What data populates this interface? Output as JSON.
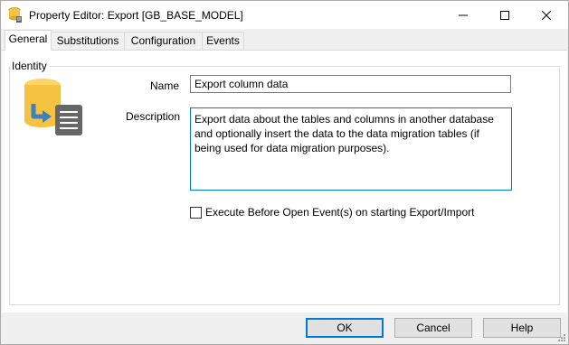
{
  "window": {
    "title": "Property Editor: Export [GB_BASE_MODEL]",
    "controls": {
      "minimize": "minimize-icon",
      "maximize": "maximize-icon",
      "close": "close-icon"
    }
  },
  "tabs": [
    {
      "label": "General",
      "active": true
    },
    {
      "label": "Substitutions",
      "active": false
    },
    {
      "label": "Configuration",
      "active": false
    },
    {
      "label": "Events",
      "active": false
    }
  ],
  "identity": {
    "group_label": "Identity",
    "icon": "database-export-icon",
    "name_label": "Name",
    "name_value": "Export column data",
    "description_label": "Description",
    "description_value": "Export data about the tables and columns in another database\nand optionally insert the data to the data migration tables (if\nbeing used for data migration purposes).",
    "checkbox_label": "Execute Before Open Event(s) on starting Export/Import",
    "checkbox_checked": false
  },
  "footer": {
    "ok_label": "OK",
    "cancel_label": "Cancel",
    "help_label": "Help"
  },
  "colors": {
    "accent": "#0078d7",
    "db_gold": "#f5c242",
    "arrow_blue": "#3b82c4",
    "doc_gray": "#666666"
  }
}
